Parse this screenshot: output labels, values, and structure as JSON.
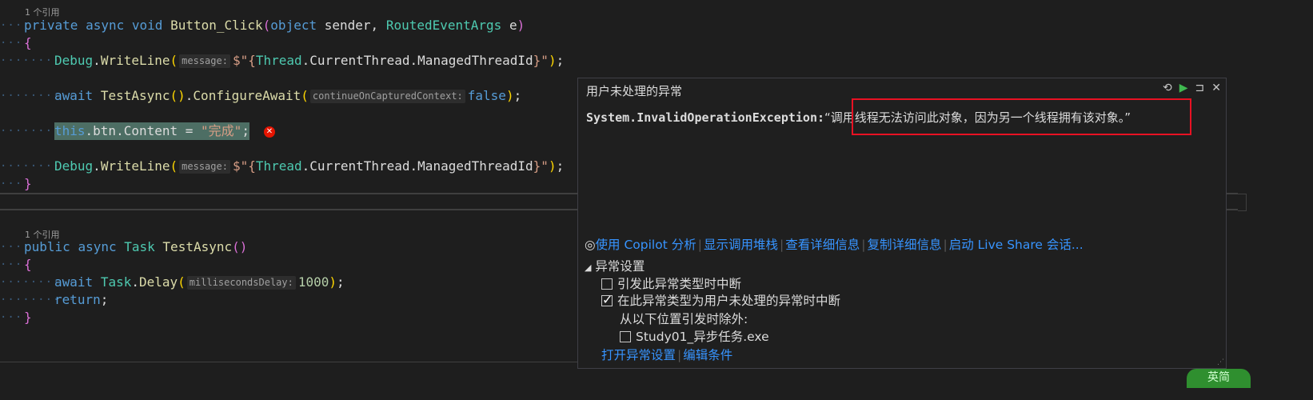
{
  "editor": {
    "method1": {
      "codelens": "1 个引用",
      "sig_kw1": "private",
      "sig_kw2": "async",
      "sig_kw3": "void",
      "sig_name": "Button_Click",
      "sig_p1_type": "object",
      "sig_p1_name": "sender,",
      "sig_p2_type": "RoutedEventArgs",
      "sig_p2_name": "e",
      "debug_class": "Debug",
      "writeline": "WriteLine",
      "hint_message": "message:",
      "interp_prefix": "$\"{",
      "thread": "Thread",
      "current_thread": "CurrentThread",
      "managed_id": "ManagedThreadId",
      "interp_suffix": "}\"",
      "await_kw": "await",
      "test_async_call": "TestAsync",
      "configure_await": "ConfigureAwait",
      "hint_continue": "continueOnCapturedContext:",
      "false_kw": "false",
      "this_line_this": "this",
      "this_line_rest": ".btn.Content = ",
      "this_line_str": "\"完成\"",
      "this_line_end": ";"
    },
    "method2": {
      "codelens": "1 个引用",
      "sig_kw1": "public",
      "sig_kw2": "async",
      "sig_type": "Task",
      "sig_name": "TestAsync",
      "await_kw": "await",
      "task": "Task",
      "delay": "Delay",
      "hint_ms": "millisecondsDelay:",
      "ms_value": "1000",
      "return_kw": "return"
    }
  },
  "exception_popup": {
    "title": "用户未处理的异常",
    "exception_type": "System.InvalidOperationException:",
    "message": "“调用线程无法访问此对象，因为另一个线程拥有该对象。”",
    "links": [
      "使用 Copilot 分析",
      "显示调用堆栈",
      "查看详细信息",
      "复制详细信息",
      "启动 Live Share 会话..."
    ],
    "settings_header": "异常设置",
    "opt_break_on_thrown": "引发此异常类型时中断",
    "opt_break_on_unhandled": "在此异常类型为用户未处理的异常时中断",
    "except_from": "从以下位置引发时除外:",
    "module_exe": "Study01_异步任务.exe",
    "open_settings": "打开异常设置",
    "edit_conditions": "编辑条件",
    "opt_break_on_thrown_checked": false,
    "opt_break_on_unhandled_checked": true,
    "module_checked": false
  },
  "status_badge": "英简"
}
